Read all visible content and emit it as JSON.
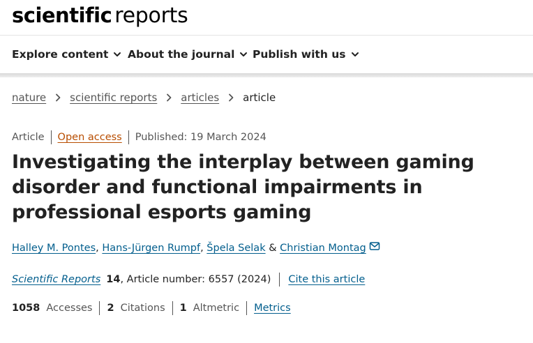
{
  "header": {
    "logo_word1": "scientific",
    "logo_word2": "reports"
  },
  "nav": {
    "items": [
      {
        "label": "Explore content"
      },
      {
        "label": "About the journal"
      },
      {
        "label": "Publish with us"
      }
    ]
  },
  "breadcrumb": {
    "items": [
      "nature",
      "scientific reports",
      "articles"
    ],
    "current": "article"
  },
  "article": {
    "type": "Article",
    "access": "Open access",
    "published": "Published: 19 March 2024",
    "title": "Investigating the interplay between gaming disorder and functional impairments in professional esports gaming",
    "authors": [
      "Halley M. Pontes",
      "Hans-Jürgen Rumpf",
      "Špela Selak",
      "Christian Montag"
    ],
    "author_sep": ",",
    "author_amp": "&",
    "corresponding_icon": "mail-icon",
    "journal": "Scientific Reports",
    "volume": "14",
    "article_number": ", Article number: 6557 (2024)",
    "cite_label": "Cite this article"
  },
  "metrics": {
    "accesses_value": "1058",
    "accesses_label": "Accesses",
    "citations_value": "2",
    "citations_label": "Citations",
    "altmetric_value": "1",
    "altmetric_label": "Altmetric",
    "metrics_link": "Metrics"
  },
  "colors": {
    "link": "#025e8d",
    "open_access": "#b84d00",
    "text": "#222222",
    "muted": "#555555"
  }
}
